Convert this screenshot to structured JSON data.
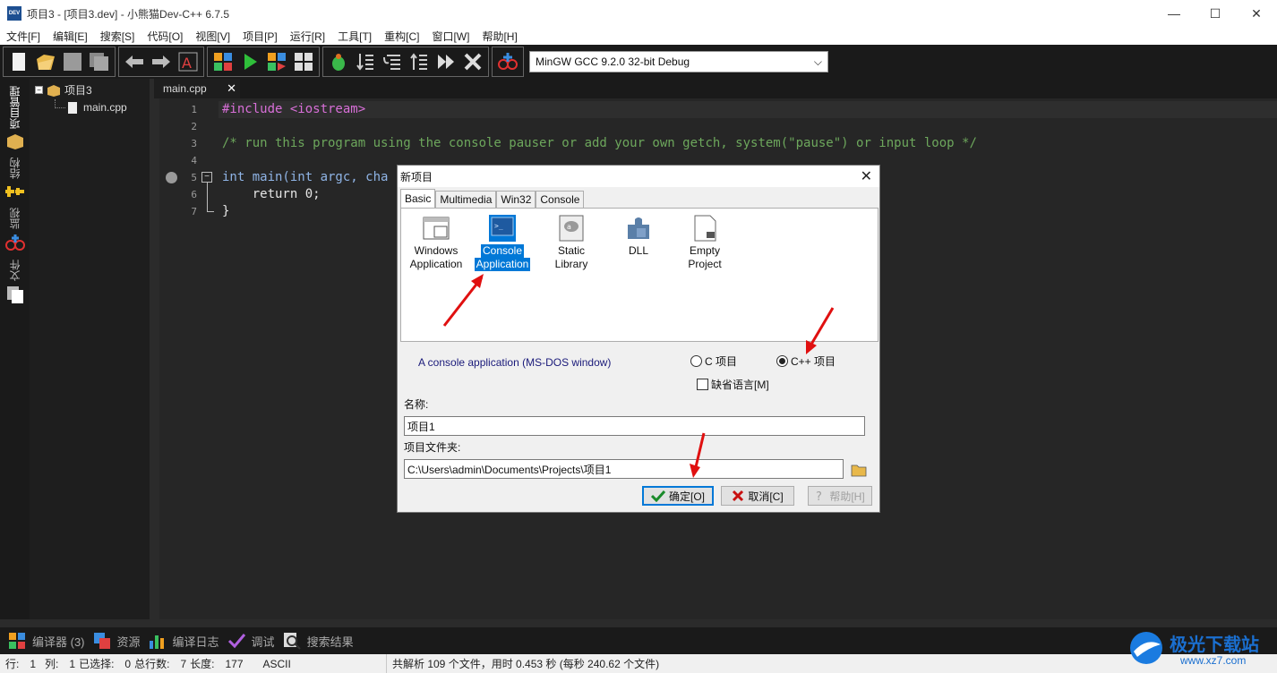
{
  "window": {
    "title": "项目3 - [项目3.dev] - 小熊猫Dev-C++ 6.7.5",
    "icon_label": "DEV",
    "minimize": "—",
    "maximize": "☐",
    "close": "✕"
  },
  "menu": [
    "文件[F]",
    "编辑[E]",
    "搜索[S]",
    "代码[O]",
    "视图[V]",
    "项目[P]",
    "运行[R]",
    "工具[T]",
    "重构[C]",
    "窗口[W]",
    "帮助[H]"
  ],
  "toolbar": {
    "compiler": "MinGW GCC 9.2.0 32-bit Debug"
  },
  "left_tabs": [
    "项目管理",
    "结构",
    "监视",
    "文件"
  ],
  "tree": {
    "project": "项目3",
    "file": "main.cpp"
  },
  "editor": {
    "tab_label": "main.cpp",
    "tab_close": "✕",
    "line_numbers": [
      "1",
      "2",
      "3",
      "4",
      "5",
      "6",
      "7"
    ],
    "lines": [
      "#include <iostream>",
      "",
      "/* run this program using the console pauser or add your own getch, system(\"pause\") or input loop */",
      "",
      "int main(int argc, cha",
      "    return 0;",
      "}"
    ]
  },
  "bottom_tabs": [
    "编译器 (3)",
    "资源",
    "编译日志",
    "调试",
    "搜索结果"
  ],
  "status": {
    "row_label": "行:",
    "row": "1",
    "col_label": "列:",
    "col": "1",
    "sel_label": "已选择:",
    "sel": "0",
    "lines_label": "总行数:",
    "lines": "7",
    "len_label": "长度:",
    "len": "177",
    "encoding": "ASCII",
    "parse": "共解析 109 个文件，用时 0.453 秒 (每秒 240.62 个文件)"
  },
  "watermark": {
    "name": "极光下载站",
    "url": "www.xz7.com"
  },
  "dialog": {
    "title": "新项目",
    "close": "✕",
    "tabs": [
      "Basic",
      "Multimedia",
      "Win32",
      "Console"
    ],
    "active_tab": "Basic",
    "templates": [
      {
        "line1": "Windows",
        "line2": "Application"
      },
      {
        "line1": "Console",
        "line2": "Application"
      },
      {
        "line1": "Static Library",
        "line2": ""
      },
      {
        "line1": "DLL",
        "line2": ""
      },
      {
        "line1": "Empty",
        "line2": "Project"
      }
    ],
    "selected_template": "Console Application",
    "description": "A console application (MS-DOS window)",
    "radio_c": "C 项目",
    "radio_cpp": "C++ 项目",
    "selected_language": "C++ 项目",
    "default_lang": "缺省语言[M]",
    "name_label": "名称:",
    "name_value": "项目1",
    "folder_label": "项目文件夹:",
    "folder_value": "C:\\Users\\admin\\Documents\\Projects\\项目1",
    "ok": "确定[O]",
    "cancel": "取消[C]",
    "help": "帮助[H]"
  },
  "colors": {
    "annotation_arrow": "#e01010",
    "selection": "#0078d7",
    "keyword": "#8fb4e6",
    "preprocessor": "#d86fd8",
    "comment": "#6da75c"
  }
}
